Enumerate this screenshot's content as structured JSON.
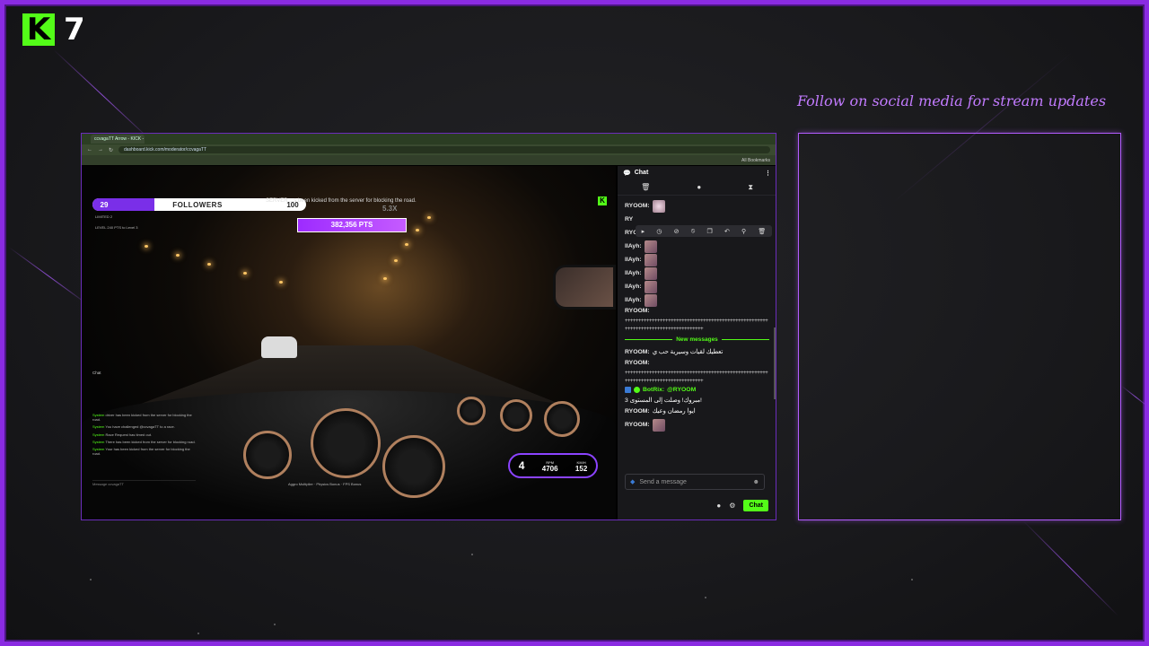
{
  "brand": {
    "logo_letter": "K",
    "number": "7",
    "accent": "#53fc18"
  },
  "tagline": "Follow on social media for stream updates",
  "theme": {
    "frame": "#8a2be2",
    "purple": "#b35cff"
  },
  "browser": {
    "tab_title": "ccvagaTT Arrow - KICK - Sl...",
    "url": "dashboard.kick.com/moderator/ccvagaTT",
    "bookmarks": "All Bookmarks"
  },
  "game_overlay": {
    "followers_current": "29",
    "followers_label": "FOLLOWERS",
    "followers_goal": "100",
    "followers_fraction": 0.29,
    "kicked_notice": "SERVER   ...s been kicked from the server for blocking the road.",
    "points": "382,356 PTS",
    "multiplier": "5.3X",
    "stat_line": "LIMITED 2",
    "stat_line2": "LEVEL 240 PTS to Level 3",
    "side_chat_title": "Chat",
    "side_chat_messages": [
      {
        "name": "System",
        "text": "driver has been kicked from the server for blocking the road."
      },
      {
        "name": "System",
        "text": "You have challenged @ccvagaTT to a race."
      },
      {
        "name": "System",
        "text": "Race Request has timed out."
      },
      {
        "name": "System",
        "text": "There has been kicked from the server for blocking road."
      },
      {
        "name": "System",
        "text": "Your has been kicked from the server for blocking the road."
      }
    ],
    "side_chat_input": "Message ccvagaTT",
    "hud": {
      "gear": "4",
      "rpm": "4706",
      "rpm_label": "RPM",
      "kmh": "152",
      "kmh_label": "KM/H"
    },
    "bonuses": "Aggro Multiplier  ·  Physics Bonus  ·  FPS Bonus"
  },
  "chat": {
    "title": "Chat",
    "msg_toolbar_icons": [
      "play-icon",
      "clock-icon",
      "slash-icon",
      "ban-icon",
      "copy-icon",
      "undo-icon",
      "pin-icon",
      "trash-icon"
    ],
    "messages": [
      {
        "user": "RYOOM:",
        "emote": true,
        "cat": true
      },
      {
        "user": "RY",
        "emote": false
      },
      {
        "user": "RYOOM:",
        "text": "...",
        "emote": false
      },
      {
        "user": "llAyh:",
        "emote": true
      },
      {
        "user": "llAyh:",
        "emote": true
      },
      {
        "user": "llAyh:",
        "emote": true
      },
      {
        "user": "llAyh:",
        "emote": true
      },
      {
        "user": "llAyh:",
        "emote": true
      }
    ],
    "flood_user": "RYOOM:",
    "flood_text": "++++++++++++++++++++++++++++++++++++++++++++++++++++++++++++++++++++++++++++++++++",
    "new_messages": "New messages",
    "after": [
      {
        "user": "RYOOM:",
        "text": "تعطيك لقيات وسيرية حب ي"
      },
      {
        "user": "RYOOM:",
        "text": ""
      }
    ],
    "flood_text_2": "++++++++++++++++++++++++++++++++++++++++++++++++++++++++++++++++++++++++++++++++++",
    "bot_user": "BotRix:",
    "bot_mention": "@RYOOM",
    "bot_text": "مبروك! وصلت إلى المستوى 3!",
    "after2": [
      {
        "user": "RYOOM:",
        "text": "ايوا رمضان وعيك"
      },
      {
        "user": "RYOOM:",
        "emote": true
      }
    ],
    "input_placeholder": "Send a message",
    "send_label": "Chat"
  }
}
